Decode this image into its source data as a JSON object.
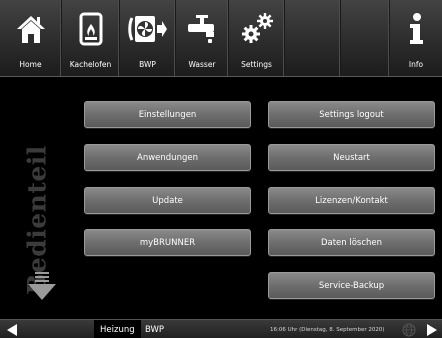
{
  "nav": {
    "items": [
      {
        "label": "Home",
        "icon": "house-icon"
      },
      {
        "label": "Kachelofen",
        "icon": "stove-icon"
      },
      {
        "label": "BWP",
        "icon": "fan-unit-icon"
      },
      {
        "label": "Wasser",
        "icon": "faucet-icon"
      },
      {
        "label": "Settings",
        "icon": "gears-icon"
      },
      {
        "label": "",
        "icon": ""
      },
      {
        "label": "Info",
        "icon": "info-icon"
      }
    ]
  },
  "side_caption": "Bedienteil",
  "menu": {
    "left": [
      "Einstellungen",
      "Anwendungen",
      "Update",
      "myBRUNNER"
    ],
    "right": [
      "Settings logout",
      "Neustart",
      "Lizenzen/Kontakt",
      "Daten löschen",
      "Service-Backup"
    ]
  },
  "bottom": {
    "tabs": [
      "Heizung",
      "BWP"
    ],
    "status": "16:06 Uhr (Dienstag, 8. September 2020)"
  },
  "colors": {
    "topbar": "#333333",
    "button": "#6e6e6e",
    "background": "#000000",
    "caption": "#3b3b3b"
  }
}
